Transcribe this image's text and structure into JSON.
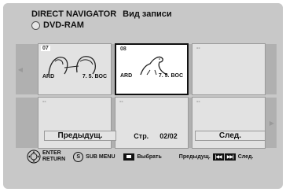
{
  "header": {
    "title": "DIRECT NAVIGATOR",
    "subtitle": "Вид записи",
    "media": "DVD-RAM"
  },
  "thumbnails": [
    {
      "num": "07",
      "channel": "ARD",
      "date": "7. 5. BOC",
      "state": "filled"
    },
    {
      "num": "08",
      "channel": "ARD",
      "date": "7. 5. BOC",
      "state": "selected"
    },
    {
      "num": "--",
      "channel": "",
      "date": "",
      "state": "empty"
    },
    {
      "num": "--",
      "channel": "",
      "date": "",
      "state": "empty"
    },
    {
      "num": "--",
      "channel": "",
      "date": "",
      "state": "empty"
    },
    {
      "num": "--",
      "channel": "",
      "date": "",
      "state": "empty"
    }
  ],
  "pager": {
    "prev_label": "Предыдущ.",
    "page_label": "Стр.",
    "page_value": "02/02",
    "next_label": "След."
  },
  "footer": {
    "enter_label": "ENTER",
    "return_label": "RETURN",
    "submenu_letter": "S",
    "submenu_label": "SUB MENU",
    "select_label": "Выбрать",
    "prev_label": "Предыдущ.",
    "next_label": "След."
  }
}
